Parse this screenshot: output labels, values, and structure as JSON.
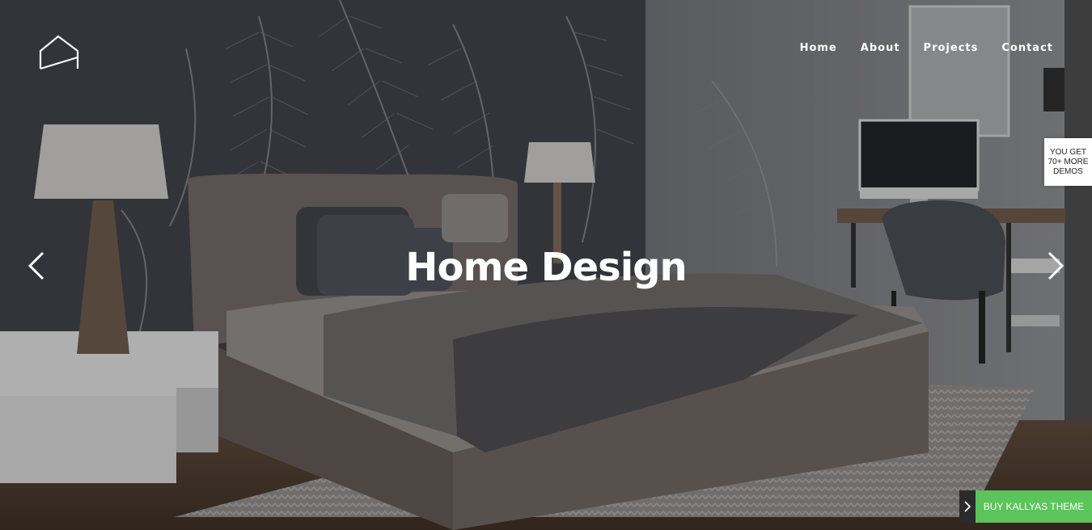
{
  "nav": {
    "items": [
      {
        "label": "Home"
      },
      {
        "label": "About"
      },
      {
        "label": "Projects"
      },
      {
        "label": "Contact"
      }
    ]
  },
  "hero": {
    "title": "Home Design",
    "background": "bedroom-interior-photo"
  },
  "slider": {
    "prev_icon": "chevron-left-icon",
    "next_icon": "chevron-right-icon"
  },
  "side_badge": {
    "line1": "YOU GET",
    "line2": "70+ MORE",
    "line3": "DEMOS"
  },
  "buy": {
    "label": "BUY KALLYAS THEME",
    "toggle_icon": "chevron-right-icon",
    "color": "#5bc45a"
  },
  "logo": {
    "icon": "house-outline-icon"
  }
}
